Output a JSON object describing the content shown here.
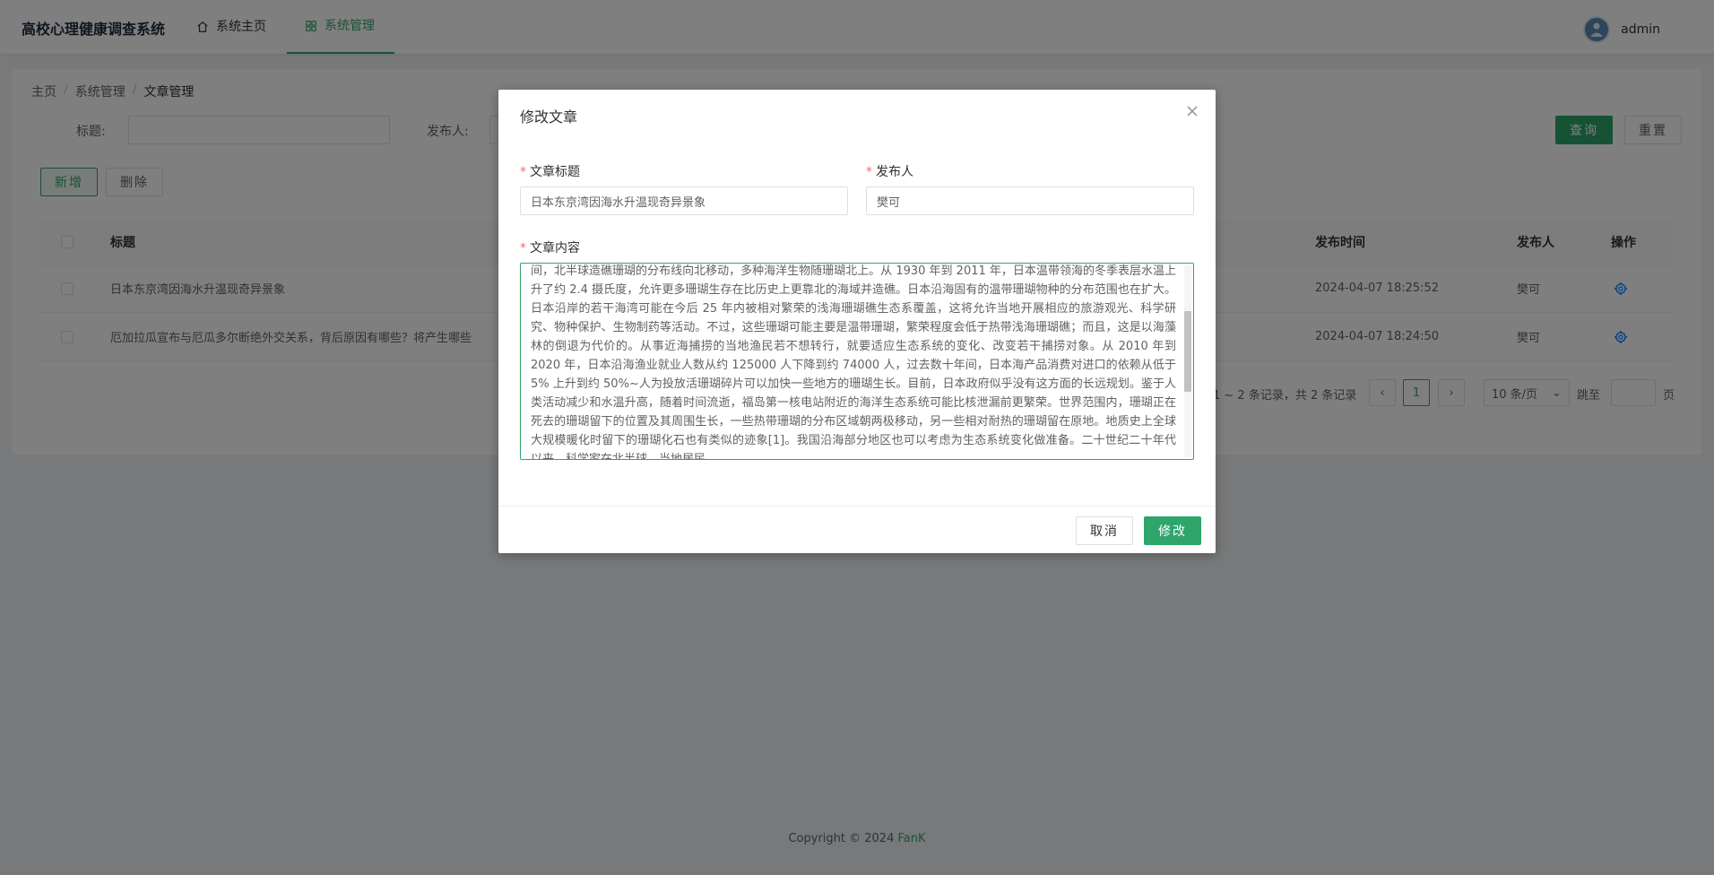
{
  "header": {
    "app_title": "高校心理健康调查系统",
    "nav": [
      {
        "label": "系统主页",
        "icon": "home-icon"
      },
      {
        "label": "系统管理",
        "icon": "grid-icon"
      }
    ],
    "user": {
      "name": "admin"
    }
  },
  "breadcrumb": [
    "主页",
    "系统管理",
    "文章管理"
  ],
  "filters": {
    "title_label": "标题:",
    "publisher_label": "发布人:",
    "search_button": "查询",
    "reset_button": "重置"
  },
  "toolbar": {
    "add_button": "新增",
    "delete_button": "删除"
  },
  "table": {
    "columns": [
      "标题",
      "发布时间",
      "发布人",
      "操作"
    ],
    "rows": [
      {
        "title": "日本东京湾因海水升温现奇异景象",
        "time": "2024-04-07 18:25:52",
        "publisher": "樊可"
      },
      {
        "title": "厄加拉瓜宣布与厄瓜多尔断绝外交关系，背后原因有哪些？将产生哪些",
        "time": "2024-04-07 18:24:50",
        "publisher": "樊可"
      }
    ]
  },
  "pagination": {
    "summary": "1 ~ 2 条记录，共 2 条记录",
    "current_page": "1",
    "page_size": "10 条/页",
    "jump_label": "跳至",
    "page_suffix": "页"
  },
  "footer": {
    "copyright": "Copyright © 2024 ",
    "author": "FanK"
  },
  "modal": {
    "title": "修改文章",
    "title_field_label": "文章标题",
    "title_field_value": "日本东京湾因海水升温现奇异景象",
    "publisher_field_label": "发布人",
    "publisher_field_value": "樊可",
    "content_label": "文章内容",
    "content_value": "间，北半球造礁珊瑚的分布线向北移动，多种海洋生物随珊瑚北上。从 1930 年到 2011 年，日本温带领海的冬季表层水温上升了约 2.4 摄氏度，允许更多珊瑚生存在比历史上更靠北的海域并造礁。日本沿海固有的温带珊瑚物种的分布范围也在扩大。日本沿岸的若干海湾可能在今后 25 年内被相对繁荣的浅海珊瑚礁生态系覆盖，这将允许当地开展相应的旅游观光、科学研究、物种保护、生物制药等活动。不过，这些珊瑚可能主要是温带珊瑚，繁荣程度会低于热带浅海珊瑚礁；而且，这是以海藻林的倒退为代价的。从事近海捕捞的当地渔民若不想转行，就要适应生态系统的变化、改变若干捕捞对象。从 2010 年到 2020 年，日本沿海渔业就业人数从约 125000 人下降到约 74000 人，过去数十年间，日本海产品消费对进口的依赖从低于 5% 上升到约 50%~人为投放活珊瑚碎片可以加快一些地方的珊瑚生长。目前，日本政府似乎没有这方面的长远规划。鉴于人类活动减少和水温升高，随着时间流逝，福岛第一核电站附近的海洋生态系统可能比核泄漏前更繁荣。世界范围内，珊瑚正在死去的珊瑚留下的位置及其周围生长，一些热带珊瑚的分布区域朝两极移动，另一些相对耐热的珊瑚留在原地。地质史上全球大规模暖化时留下的珊瑚化石也有类似的迹象[1]。我国沿海部分地区也可以考虑为生态系统变化做准备。二十世纪二十年代以来，科学家在北半球、当地居民",
    "cancel_button": "取消",
    "submit_button": "修改"
  },
  "colors": {
    "brand": "#2fa56b",
    "required": "#f56c6c",
    "action_icon": "#1890ff"
  }
}
